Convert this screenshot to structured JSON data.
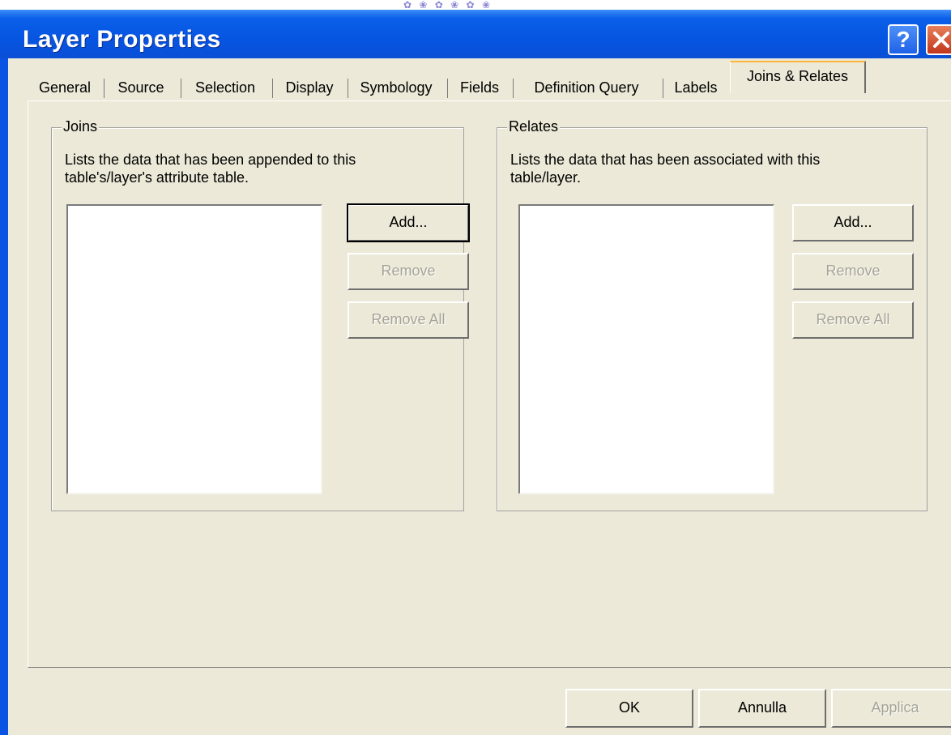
{
  "window": {
    "title": "Layer Properties",
    "help_label": "?",
    "background_decor": "✿ ❀ ✿ ❀ ✿ ❀"
  },
  "tabs": [
    {
      "label": "General"
    },
    {
      "label": "Source"
    },
    {
      "label": "Selection"
    },
    {
      "label": "Display"
    },
    {
      "label": "Symbology"
    },
    {
      "label": "Fields"
    },
    {
      "label": "Definition Query"
    },
    {
      "label": "Labels"
    },
    {
      "label": "Joins & Relates",
      "active": true
    }
  ],
  "joins": {
    "legend": "Joins",
    "description": "Lists the data that has been appended to this table's/layer's attribute table.",
    "add_label": "Add...",
    "remove_label": "Remove",
    "remove_all_label": "Remove All"
  },
  "relates": {
    "legend": "Relates",
    "description": "Lists the data that has been associated with this table/layer.",
    "add_label": "Add...",
    "remove_label": "Remove",
    "remove_all_label": "Remove All"
  },
  "footer": {
    "ok_label": "OK",
    "cancel_label": "Annulla",
    "apply_label": "Applica"
  },
  "colors": {
    "titlebar": "#0655e2",
    "dialog_bg": "#ece9d8",
    "disabled_text": "#a6a396"
  }
}
